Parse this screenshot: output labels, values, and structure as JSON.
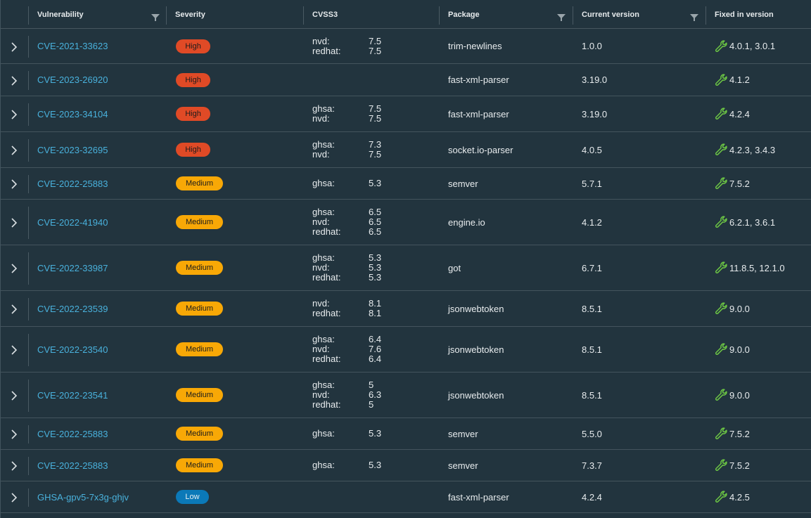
{
  "columns": {
    "vulnerability": "Vulnerability",
    "severity": "Severity",
    "cvss3": "CVSS3",
    "package": "Package",
    "current_version": "Current version",
    "fixed_in_version": "Fixed in version"
  },
  "colors": {
    "link": "#49b1dc",
    "high": "#e04a26",
    "medium": "#f8a806",
    "low": "#0b79b8",
    "wrench": "#6cc644"
  },
  "rows": [
    {
      "id": "CVE-2021-33623",
      "severity": "High",
      "cvss": [
        {
          "src": "nvd:",
          "val": "7.5"
        },
        {
          "src": "redhat:",
          "val": "7.5"
        }
      ],
      "package": "trim-newlines",
      "current": "1.0.0",
      "fixed": "4.0.1, 3.0.1"
    },
    {
      "id": "CVE-2023-26920",
      "severity": "High",
      "cvss": [],
      "package": "fast-xml-parser",
      "current": "3.19.0",
      "fixed": "4.1.2"
    },
    {
      "id": "CVE-2023-34104",
      "severity": "High",
      "cvss": [
        {
          "src": "ghsa:",
          "val": "7.5"
        },
        {
          "src": "nvd:",
          "val": "7.5"
        }
      ],
      "package": "fast-xml-parser",
      "current": "3.19.0",
      "fixed": "4.2.4"
    },
    {
      "id": "CVE-2023-32695",
      "severity": "High",
      "cvss": [
        {
          "src": "ghsa:",
          "val": "7.3"
        },
        {
          "src": "nvd:",
          "val": "7.5"
        }
      ],
      "package": "socket.io-parser",
      "current": "4.0.5",
      "fixed": "4.2.3, 3.4.3"
    },
    {
      "id": "CVE-2022-25883",
      "severity": "Medium",
      "cvss": [
        {
          "src": "ghsa:",
          "val": "5.3"
        }
      ],
      "package": "semver",
      "current": "5.7.1",
      "fixed": "7.5.2"
    },
    {
      "id": "CVE-2022-41940",
      "severity": "Medium",
      "cvss": [
        {
          "src": "ghsa:",
          "val": "6.5"
        },
        {
          "src": "nvd:",
          "val": "6.5"
        },
        {
          "src": "redhat:",
          "val": "6.5"
        }
      ],
      "package": "engine.io",
      "current": "4.1.2",
      "fixed": "6.2.1, 3.6.1"
    },
    {
      "id": "CVE-2022-33987",
      "severity": "Medium",
      "cvss": [
        {
          "src": "ghsa:",
          "val": "5.3"
        },
        {
          "src": "nvd:",
          "val": "5.3"
        },
        {
          "src": "redhat:",
          "val": "5.3"
        }
      ],
      "package": "got",
      "current": "6.7.1",
      "fixed": "11.8.5, 12.1.0"
    },
    {
      "id": "CVE-2022-23539",
      "severity": "Medium",
      "cvss": [
        {
          "src": "nvd:",
          "val": "8.1"
        },
        {
          "src": "redhat:",
          "val": "8.1"
        }
      ],
      "package": "jsonwebtoken",
      "current": "8.5.1",
      "fixed": "9.0.0"
    },
    {
      "id": "CVE-2022-23540",
      "severity": "Medium",
      "cvss": [
        {
          "src": "ghsa:",
          "val": "6.4"
        },
        {
          "src": "nvd:",
          "val": "7.6"
        },
        {
          "src": "redhat:",
          "val": "6.4"
        }
      ],
      "package": "jsonwebtoken",
      "current": "8.5.1",
      "fixed": "9.0.0"
    },
    {
      "id": "CVE-2022-23541",
      "severity": "Medium",
      "cvss": [
        {
          "src": "ghsa:",
          "val": "5"
        },
        {
          "src": "nvd:",
          "val": "6.3"
        },
        {
          "src": "redhat:",
          "val": "5"
        }
      ],
      "package": "jsonwebtoken",
      "current": "8.5.1",
      "fixed": "9.0.0"
    },
    {
      "id": "CVE-2022-25883",
      "severity": "Medium",
      "cvss": [
        {
          "src": "ghsa:",
          "val": "5.3"
        }
      ],
      "package": "semver",
      "current": "5.5.0",
      "fixed": "7.5.2"
    },
    {
      "id": "CVE-2022-25883",
      "severity": "Medium",
      "cvss": [
        {
          "src": "ghsa:",
          "val": "5.3"
        }
      ],
      "package": "semver",
      "current": "7.3.7",
      "fixed": "7.5.2"
    },
    {
      "id": "GHSA-gpv5-7x3g-ghjv",
      "severity": "Low",
      "cvss": [],
      "package": "fast-xml-parser",
      "current": "4.2.4",
      "fixed": "4.2.5"
    }
  ]
}
